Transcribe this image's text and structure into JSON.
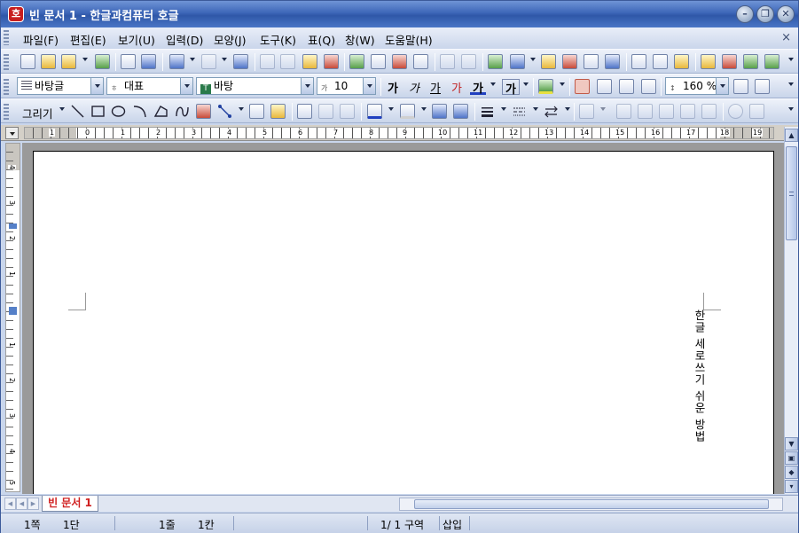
{
  "window": {
    "title": "빈 문서 1 - 한글과컴퓨터 호글",
    "app_icon_glyph": "호",
    "controls": [
      "minimize",
      "restore",
      "close"
    ]
  },
  "menu": {
    "items": [
      "파일(F)",
      "편집(E)",
      "보기(U)",
      "입력(D)",
      "모양(J)",
      "도구(K)",
      "표(Q)",
      "창(W)",
      "도움말(H)"
    ],
    "close_glyph": "×"
  },
  "format_toolbar": {
    "style": "바탕글",
    "font_lang": "대표",
    "font": "바탕",
    "font_size": "10",
    "zoom": "160 %",
    "bold": "가",
    "italic": "가",
    "underline": "가",
    "strike": "가",
    "font_color": "가",
    "char_shape": "가"
  },
  "draw_toolbar": {
    "label": "그리기"
  },
  "ruler": {
    "numbers": [
      "1",
      "0",
      "1",
      "2",
      "3",
      "4",
      "5",
      "6",
      "7",
      "8",
      "9",
      "10",
      "11",
      "12",
      "13",
      "14",
      "15",
      "16",
      "17",
      "18",
      "19"
    ],
    "vnumbers": [
      "4",
      "3",
      "2",
      "1",
      "1",
      "2",
      "3",
      "4",
      "5"
    ]
  },
  "document": {
    "text": "한글 세로쓰기 쉬운 방법"
  },
  "tabs": {
    "active": "빈 문서 1"
  },
  "status": {
    "page": "1쪽",
    "column": "1단",
    "line": "1줄",
    "col_char": "1칸",
    "section": "1/  1 구역",
    "mode": "삽입"
  },
  "colors": {
    "accent": "#3d66b8",
    "tab_text": "#d02020",
    "highlight": "#e8c0b8"
  }
}
